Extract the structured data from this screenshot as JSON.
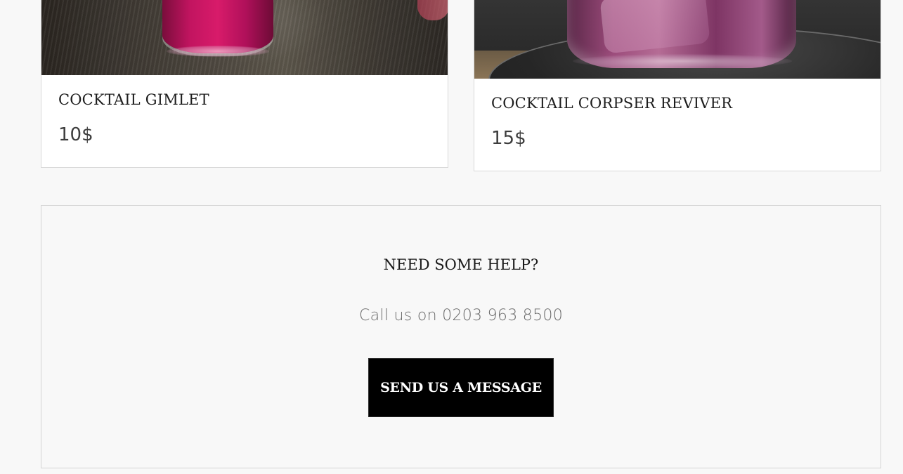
{
  "products": [
    {
      "title": "COCKTAIL GIMLET",
      "price": "10$",
      "image_alt": "cocktail-gimlet-photo"
    },
    {
      "title": "COCKTAIL CORPSER REVIVER",
      "price": "15$",
      "image_alt": "cocktail-corpser-reviver-photo"
    }
  ],
  "help": {
    "heading": "NEED SOME HELP?",
    "phone_text": "Call us on 0203 963 8500",
    "button_label": "SEND US A MESSAGE"
  },
  "colors": {
    "page_background": "#f8f8f8",
    "card_background": "#ffffff",
    "button_background": "#000000",
    "button_text": "#ffffff",
    "heading_text": "#1a1a1a",
    "phone_text": "#6a6a6a",
    "border": "#d9d9d9"
  }
}
